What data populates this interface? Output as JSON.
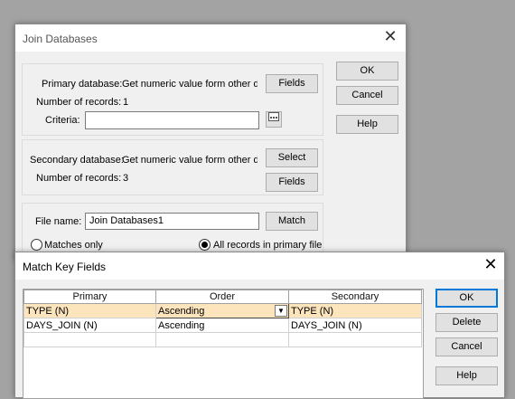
{
  "join_dialog": {
    "title": "Join Databases",
    "close_glyph": "✕",
    "primary_db_label": "Primary database:",
    "primary_db_value": "Get numeric value form other da",
    "records_label": "Number of records:",
    "primary_records": "1",
    "criteria_label": "Criteria:",
    "criteria_value": "",
    "secondary_db_label": "Secondary database:",
    "secondary_db_value": "Get numeric value form other da",
    "secondary_records": "3",
    "file_name_label": "File name:",
    "file_name_value": "Join Databases1",
    "fields_label": "Fields",
    "select_label": "Select",
    "match_label": "Match",
    "ok_label": "OK",
    "cancel_label": "Cancel",
    "help_label": "Help",
    "matches_only_label": "Matches only",
    "all_records_label": "All records in primary file",
    "selected_radio": "all_records"
  },
  "match_dialog": {
    "title": "Match Key Fields",
    "close_glyph": "✕",
    "columns": [
      "Primary",
      "Order",
      "Secondary"
    ],
    "rows": [
      {
        "primary": "TYPE (N)",
        "order": "Ascending",
        "secondary": "TYPE (N)"
      },
      {
        "primary": "DAYS_JOIN (N)",
        "order": "Ascending",
        "secondary": "DAYS_JOIN (N)"
      },
      {
        "primary": "",
        "order": "",
        "secondary": ""
      }
    ],
    "selected_row": 0,
    "combo_arrow": "▼",
    "ok_label": "OK",
    "delete_label": "Delete",
    "cancel_label": "Cancel",
    "help_label": "Help"
  }
}
